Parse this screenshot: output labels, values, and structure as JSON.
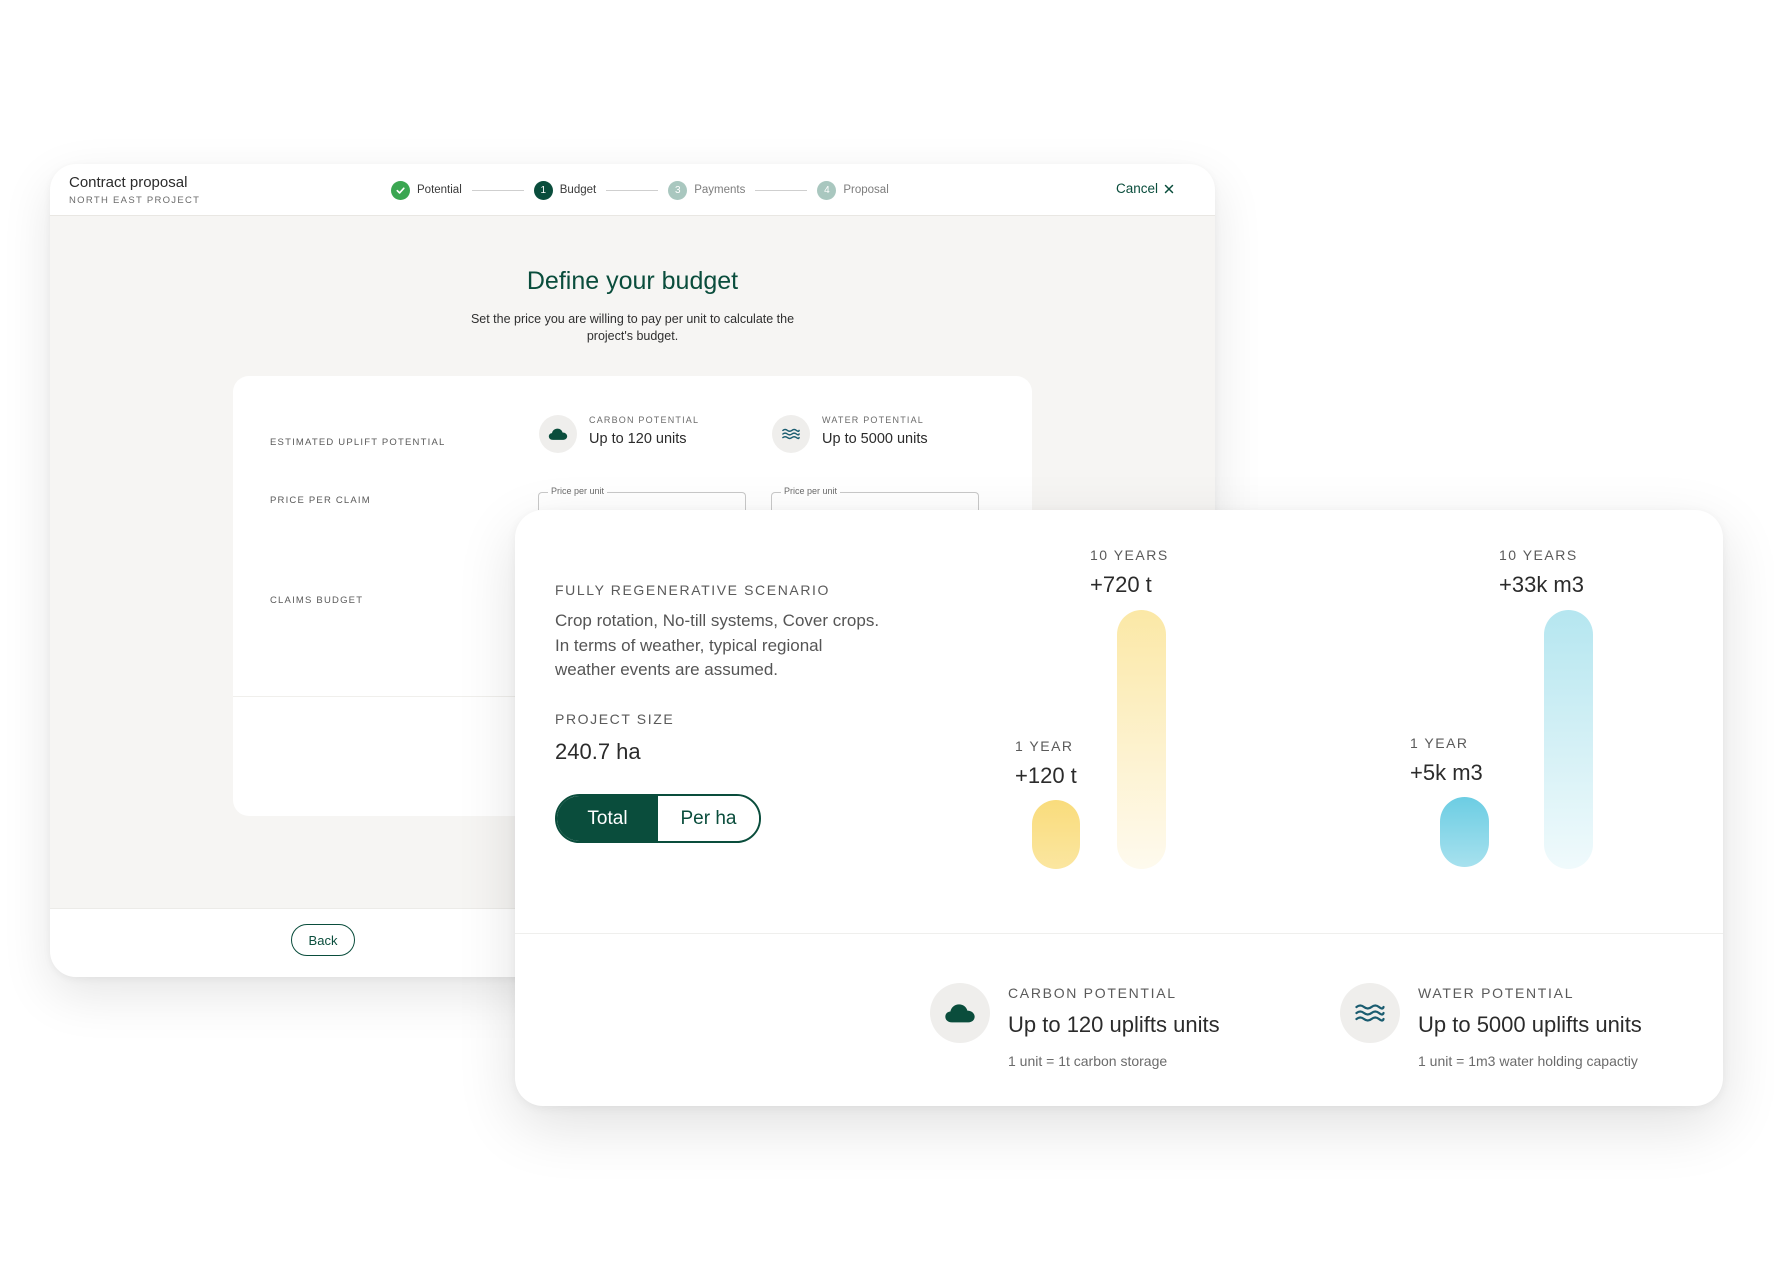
{
  "back_window": {
    "title": "Contract proposal",
    "subtitle": "NORTH EAST PROJECT",
    "steps": [
      {
        "label": "Potential",
        "status": "done",
        "marker": "✓"
      },
      {
        "label": "Budget",
        "status": "active",
        "marker": "1"
      },
      {
        "label": "Payments",
        "status": "todo",
        "marker": "3"
      },
      {
        "label": "Proposal",
        "status": "todo",
        "marker": "4"
      }
    ],
    "cancel_label": "Cancel",
    "heading": "Define your budget",
    "description": "Set the price you are willing to pay per unit to calculate the project's budget.",
    "rows": {
      "uplift": "ESTIMATED UPLIFT POTENTIAL",
      "price": "PRICE PER CLAIM",
      "budget": "CLAIMS BUDGET"
    },
    "carbon": {
      "label": "CARBON POTENTIAL",
      "value": "Up to 120 units",
      "icon": "cloud-icon"
    },
    "water": {
      "label": "WATER POTENTIAL",
      "value": "Up to 5000 units",
      "icon": "water-waves-icon"
    },
    "price_input_label": "Price per unit",
    "back_label": "Back"
  },
  "front_card": {
    "scenario_title": "FULLY REGENERATIVE SCENARIO",
    "scenario_description": "Crop rotation, No-till systems, Cover crops. In terms of weather, typical regional weather events are assumed.",
    "project_size_label": "PROJECT SIZE",
    "project_size_value": "240.7 ha",
    "toggle": {
      "total": "Total",
      "per_ha": "Per ha",
      "selected": "Total"
    },
    "carbon_bars": {
      "one_year_label": "1 YEAR",
      "one_year_value": "+120 t",
      "ten_years_label": "10 YEARS",
      "ten_years_value": "+720 t",
      "color": "#f9dc7c"
    },
    "water_bars": {
      "one_year_label": "1 YEAR",
      "one_year_value": "+5k m3",
      "ten_years_label": "10 YEARS",
      "ten_years_value": "+33k m3",
      "color": "#6ccde3"
    },
    "carbon_potential": {
      "label": "CARBON POTENTIAL",
      "value": "Up to 120 uplifts units",
      "note": "1 unit = 1t carbon storage",
      "icon": "cloud-icon"
    },
    "water_potential": {
      "label": "WATER POTENTIAL",
      "value": "Up to 5000 uplifts units",
      "note": "1 unit = 1m3 water holding capactiy",
      "icon": "water-waves-icon"
    }
  },
  "colors": {
    "brand_green": "#0a4d3c",
    "success_green": "#3aa651",
    "carbon_yellow": "#f9dc7c",
    "water_blue": "#6ccde3"
  }
}
